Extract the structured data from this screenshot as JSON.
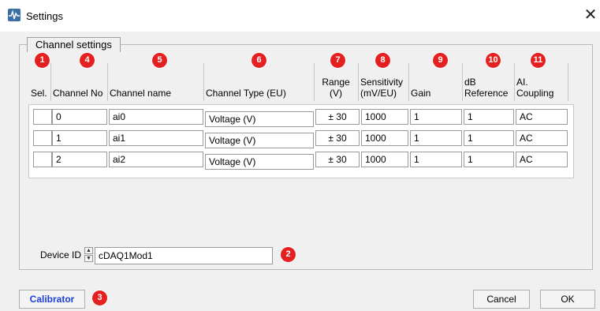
{
  "window": {
    "title": "Settings",
    "close_glyph": "✕",
    "icon": "waveform-app-icon"
  },
  "group": {
    "title": "Channel settings"
  },
  "columns": [
    {
      "label": "Sel.",
      "badge": "1"
    },
    {
      "label": "Channel No",
      "badge": "4"
    },
    {
      "label": "Channel name",
      "badge": "5"
    },
    {
      "label": "Channel Type (EU)",
      "badge": "6"
    },
    {
      "label": "Range\n(V)",
      "badge": "7"
    },
    {
      "label": "Sensitivity\n(mV/EU)",
      "badge": "8"
    },
    {
      "label": "Gain",
      "badge": "9"
    },
    {
      "label": "dB\nReference",
      "badge": "10"
    },
    {
      "label": "AI.\nCoupling",
      "badge": "11"
    }
  ],
  "rows": [
    {
      "channel_no": "0",
      "name": "ai0",
      "type": "Voltage (V)",
      "range": "± 30",
      "sensitivity": "1000",
      "gain": "1",
      "db_ref": "1",
      "coupling": "AC"
    },
    {
      "channel_no": "1",
      "name": "ai1",
      "type": "Voltage (V)",
      "range": "± 30",
      "sensitivity": "1000",
      "gain": "1",
      "db_ref": "1",
      "coupling": "AC"
    },
    {
      "channel_no": "2",
      "name": "ai2",
      "type": "Voltage (V)",
      "range": "± 30",
      "sensitivity": "1000",
      "gain": "1",
      "db_ref": "1",
      "coupling": "AC"
    }
  ],
  "device": {
    "label": "Device ID",
    "value": "cDAQ1Mod1",
    "badge": "2"
  },
  "buttons": {
    "calibrator": "Calibrator",
    "calibrator_badge": "3",
    "cancel": "Cancel",
    "ok": "OK"
  },
  "colors": {
    "badge": "#e52020",
    "calibrator_text": "#1a3fd6"
  }
}
